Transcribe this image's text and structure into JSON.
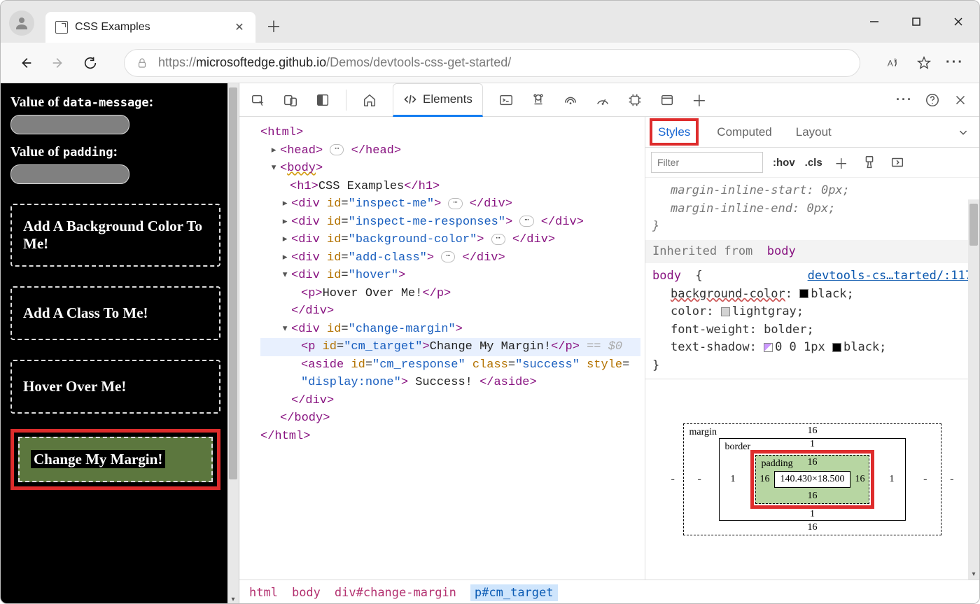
{
  "browser": {
    "tab_title": "CSS Examples",
    "url_host": "https://",
    "url_domain": "microsoftedge.github.io",
    "url_path": "/Demos/devtools-css-get-started/"
  },
  "demo": {
    "label_data_message_prefix": "Value of ",
    "label_data_message_code": "data-message",
    "label_data_message_suffix": ":",
    "label_padding_prefix": "Value of ",
    "label_padding_code": "padding",
    "label_padding_suffix": ":",
    "card_bg": "Add A Background Color To Me!",
    "card_class": "Add A Class To Me!",
    "card_hover": "Hover Over Me!",
    "card_margin": "Change My Margin!"
  },
  "devtools": {
    "elements_tab": "Elements",
    "dom": {
      "html_open": "<html>",
      "head": "<head>",
      "head_close": "</head>",
      "body": "<body>",
      "h1_open": "<h1>",
      "h1_text": "CSS Examples",
      "h1_close": "</h1>",
      "div_inspect": "inspect-me",
      "div_inspect_resp": "inspect-me-responses",
      "div_bgcolor": "background-color",
      "div_addclass": "add-class",
      "div_hover": "hover",
      "hover_p": "Hover Over Me!",
      "change_margin": "change-margin",
      "cm_target_id": "cm_target",
      "cm_target_text": "Change My Margin!",
      "cm_comment": "== $0",
      "aside_id": "cm_response",
      "aside_class": "success",
      "aside_style": "display:none",
      "aside_text": " Success! ",
      "div_close": "</div>",
      "body_close": "</body>",
      "html_close": "</html>",
      "p_close": "</p>",
      "aside_close": "</aside>"
    },
    "styles": {
      "tab_styles": "Styles",
      "tab_computed": "Computed",
      "tab_layout": "Layout",
      "filter_placeholder": "Filter",
      "hov": ":hov",
      "cls": ".cls",
      "rule_mis": "margin-inline-start",
      "rule_mis_v": "0px",
      "rule_mie": "margin-inline-end",
      "rule_mie_v": "0px",
      "inh_label": "Inherited from",
      "inh_from": "body",
      "body_sel": "body",
      "rulelink": "devtools-cs…tarted/:117",
      "bgcolor": "background-color",
      "bgcolor_v": "black",
      "color": "color",
      "color_v": "lightgray",
      "fweight": "font-weight",
      "fweight_v": "bolder",
      "tshadow": "text-shadow",
      "tshadow_v": "0 0 1px",
      "tshadow_c": "black"
    },
    "boxmodel": {
      "margin_label": "margin",
      "border_label": "border",
      "padding_label": "padding",
      "margin_val": "16",
      "border_val": "1",
      "padding_val": "16",
      "content": "140.430×18.500",
      "dash": "-"
    },
    "breadcrumb": {
      "b0": "html",
      "b1": "body",
      "b2": "div#change-margin",
      "b3": "p#cm_target"
    }
  }
}
